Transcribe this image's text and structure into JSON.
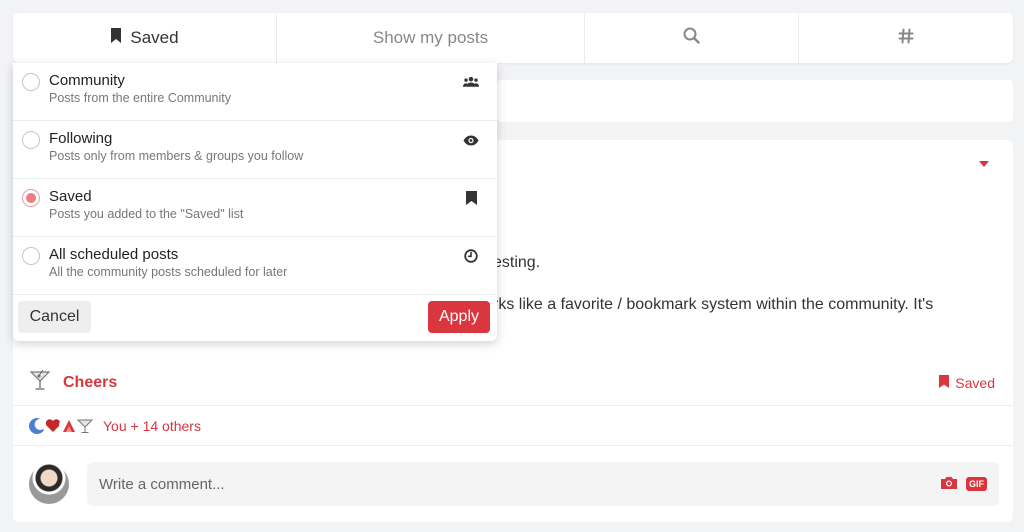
{
  "tabs": {
    "saved": "Saved",
    "my_posts": "Show my posts"
  },
  "dropdown": {
    "options": [
      {
        "title": "Community",
        "description": "Posts from the entire Community",
        "icon": "people-icon",
        "selected": false
      },
      {
        "title": "Following",
        "description": "Posts only from members & groups you follow",
        "icon": "eye-icon",
        "selected": false
      },
      {
        "title": "Saved",
        "description": "Posts you added to the \"Saved\" list",
        "icon": "bookmark-icon",
        "selected": true
      },
      {
        "title": "All scheduled posts",
        "description": "All the community posts scheduled for later",
        "icon": "clock-icon",
        "selected": false
      }
    ],
    "cancel_label": "Cancel",
    "apply_label": "Apply"
  },
  "post": {
    "text_line1_visible": "esting.",
    "text_line2_visible": "rks like a favorite / bookmark system within the community. It's",
    "reaction_label": "Cheers",
    "saved_label": "Saved",
    "reactors_text": "You + 14 others",
    "comment_placeholder": "Write a comment...",
    "gif_label": "GIF"
  },
  "colors": {
    "accent": "#d9363e",
    "radio_selected": "#ee7c80"
  }
}
